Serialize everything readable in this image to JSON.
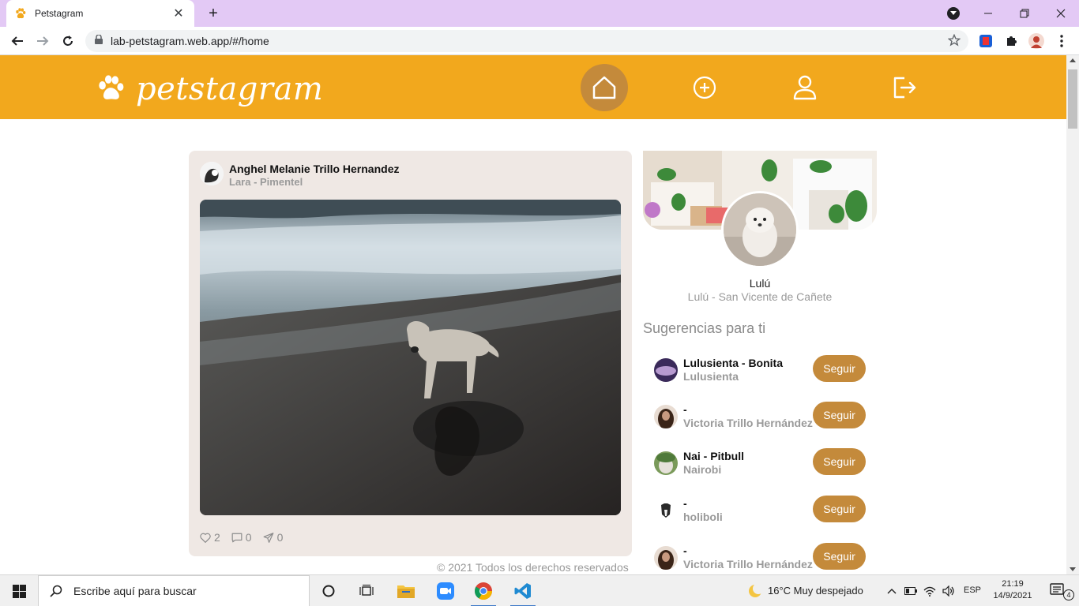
{
  "browser": {
    "tab_title": "Petstagram",
    "tab_close": "✕",
    "new_tab": "+",
    "url": "lab-petstagram.web.app/#/home"
  },
  "app": {
    "brand": "petstagram",
    "colors": {
      "header": "#f2a81d",
      "accent": "#c48a3b",
      "card": "#efe8e4"
    },
    "nav": [
      {
        "name": "home-icon",
        "active": true
      },
      {
        "name": "add-post-icon",
        "active": false
      },
      {
        "name": "profile-icon",
        "active": false
      },
      {
        "name": "logout-icon",
        "active": false
      }
    ]
  },
  "post": {
    "author": "Anghel Melanie Trillo Hernandez",
    "subtitle": "Lara - Pimentel",
    "likes": "2",
    "comments": "0",
    "shares": "0"
  },
  "profile": {
    "name": "Lulú",
    "subtitle": "Lulú - San Vicente de Cañete"
  },
  "suggestions": {
    "title": "Sugerencias para ti",
    "follow_label": "Seguir",
    "items": [
      {
        "name": "Lulusienta - Bonita",
        "sub": "Lulusienta"
      },
      {
        "name": "-",
        "sub": "Victoria Trillo Hernández"
      },
      {
        "name": "Nai - Pitbull",
        "sub": "Nairobi"
      },
      {
        "name": "-",
        "sub": "holiboli"
      },
      {
        "name": "-",
        "sub": "Victoria Trillo Hernández"
      }
    ]
  },
  "footer": "© 2021 Todos los derechos reservados",
  "taskbar": {
    "search_placeholder": "Escribe aquí para buscar",
    "weather": "16°C  Muy despejado",
    "lang": "ESP",
    "time": "21:19",
    "date": "14/9/2021",
    "notif_count": "4"
  }
}
